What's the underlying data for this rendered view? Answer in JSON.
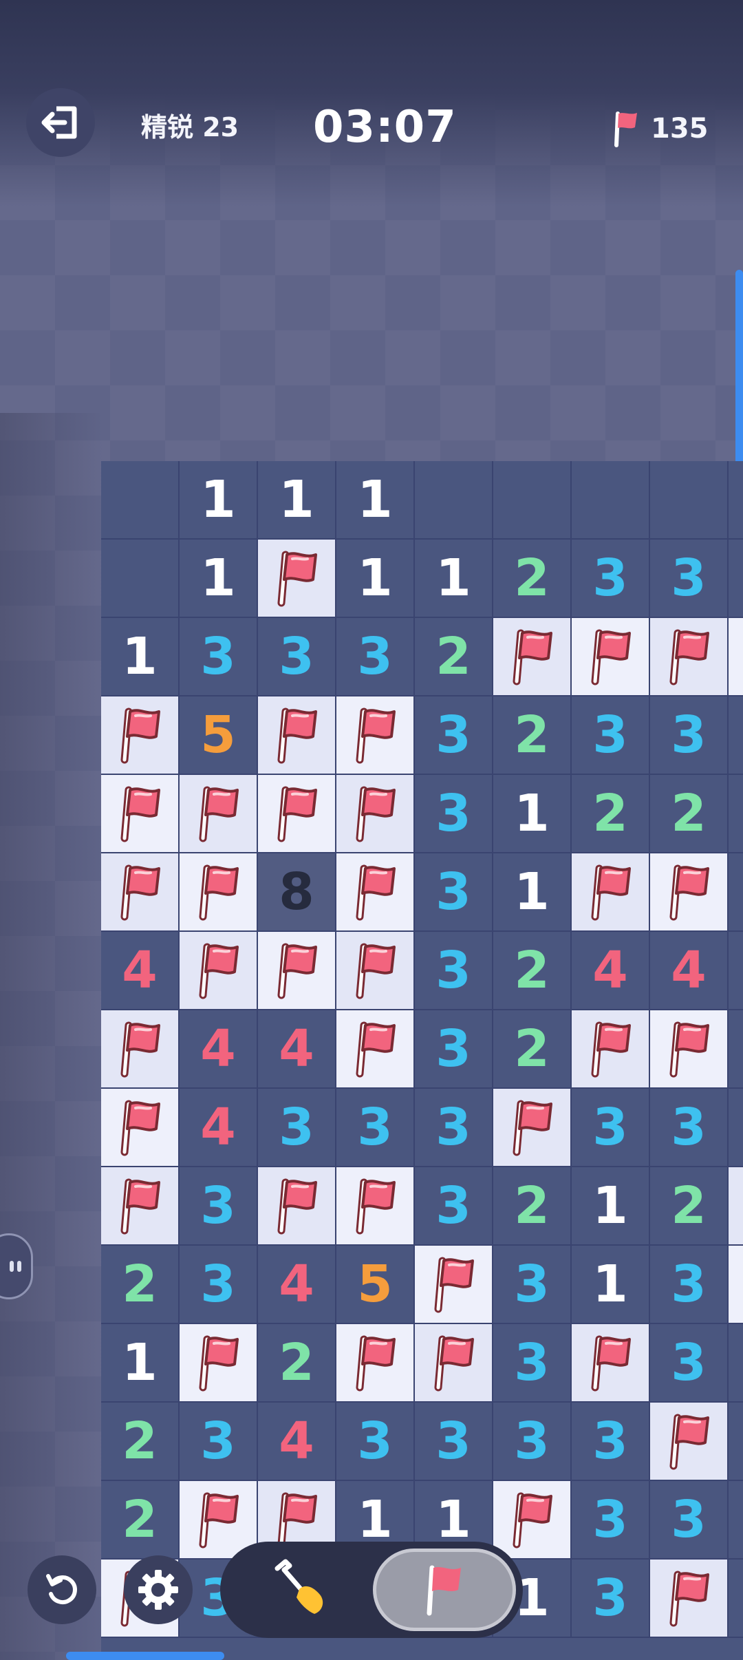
{
  "header": {
    "level_label": "精锐 23",
    "timer": "03:07",
    "flags_remaining": "135"
  },
  "icons": {
    "exit": "exit-icon",
    "flag": "flag-icon",
    "undo": "undo-icon",
    "settings": "gear-icon",
    "dig": "shovel-icon"
  },
  "colors": {
    "n1": "#ffffff",
    "n2": "#7fe3a8",
    "n3": "#3ec1f0",
    "n4": "#f2647e",
    "n5": "#f59d3c",
    "n8": "#262b3e",
    "flag": "#f2647e",
    "accent": "#3d8cf0"
  },
  "board": {
    "rows": [
      [
        "",
        "1",
        "1",
        "1",
        "",
        "",
        "",
        "",
        ""
      ],
      [
        "",
        "1",
        "F",
        "1",
        "1",
        "2",
        "3",
        "3",
        ""
      ],
      [
        "1",
        "3",
        "3",
        "3",
        "2",
        "F",
        "F",
        "F",
        "F"
      ],
      [
        "F",
        "5",
        "F",
        "F",
        "3",
        "2",
        "3",
        "3",
        ""
      ],
      [
        "F",
        "F",
        "F",
        "F",
        "3",
        "1",
        "2",
        "2",
        ""
      ],
      [
        "F",
        "F",
        "8",
        "F",
        "3",
        "1",
        "F",
        "F",
        ""
      ],
      [
        "4",
        "F",
        "F",
        "F",
        "3",
        "2",
        "4",
        "4",
        ""
      ],
      [
        "F",
        "4",
        "4",
        "F",
        "3",
        "2",
        "F",
        "F",
        ""
      ],
      [
        "F",
        "4",
        "3",
        "3",
        "3",
        "F",
        "3",
        "3",
        ""
      ],
      [
        "F",
        "3",
        "F",
        "F",
        "3",
        "2",
        "1",
        "2",
        "F"
      ],
      [
        "2",
        "3",
        "4",
        "5",
        "F",
        "3",
        "1",
        "3",
        "F"
      ],
      [
        "1",
        "F",
        "2",
        "F",
        "F",
        "3",
        "F",
        "3",
        ""
      ],
      [
        "2",
        "3",
        "4",
        "3",
        "3",
        "3",
        "3",
        "F",
        ""
      ],
      [
        "2",
        "F",
        "F",
        "1",
        "1",
        "F",
        "3",
        "3",
        ""
      ],
      [
        "F",
        "3",
        "",
        "",
        "",
        "1",
        "3",
        "F",
        ""
      ]
    ]
  },
  "mode": {
    "selected": "flag"
  }
}
